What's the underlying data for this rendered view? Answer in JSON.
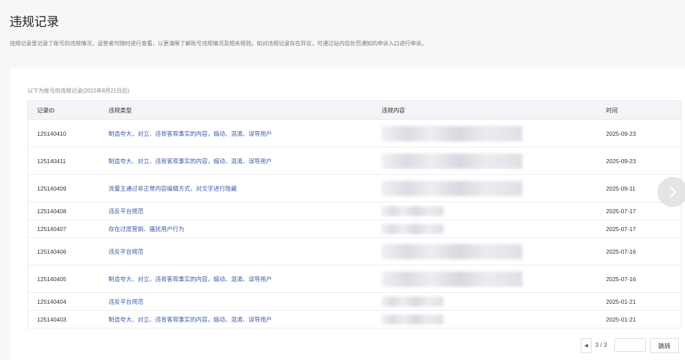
{
  "page": {
    "title": "违规记录",
    "description": "违规记录里记录了账号的违规情况，运营者可随时进行查看，以更清晰了解账号违规情况及相关规则。如对违规记录存在异议，可通过站内信处罚通知的申诉入口进行申诉。"
  },
  "table": {
    "caption": "以下为账号的违规记录(2015年8月21日后)",
    "headers": [
      "记录ID",
      "违规类型",
      "违规内容",
      "时间"
    ],
    "rows": [
      {
        "id": "125140410",
        "type": "制造夸大、对立、违背客观事实的内容，煽动、混淆、误导用户",
        "date": "2025-09-23",
        "tall": true
      },
      {
        "id": "125140411",
        "type": "制造夸大、对立、违背客观事实的内容，煽动、混淆、误导用户",
        "date": "2025-09-23",
        "tall": true
      },
      {
        "id": "125140409",
        "type": "流量主通过非正常内容编辑方式，对文字进行隐藏",
        "date": "2025-09-11",
        "tall": true
      },
      {
        "id": "125140408",
        "type": "违反平台规范",
        "date": "2025-07-17",
        "tall": false
      },
      {
        "id": "125140407",
        "type": "存在过度营销、骚扰用户行为",
        "date": "2025-07-17",
        "tall": false
      },
      {
        "id": "125140406",
        "type": "违反平台规范",
        "date": "2025-07-16",
        "tall": true
      },
      {
        "id": "125140405",
        "type": "制造夸大、对立、违背客观事实的内容，煽动、混淆、误导用户",
        "date": "2025-07-16",
        "tall": true
      },
      {
        "id": "125140404",
        "type": "违反平台规范",
        "date": "2025-01-21",
        "tall": false
      },
      {
        "id": "125140403",
        "type": "制造夸大、对立、违背客观事实的内容，煽动、混淆、误导用户",
        "date": "2025-01-21",
        "tall": false
      }
    ]
  },
  "pagination": {
    "page_text": "3 / 3",
    "input_value": "",
    "go_label": "跳转"
  },
  "icons": {
    "prev": "chevron-left-icon",
    "next": "chevron-right-icon"
  }
}
